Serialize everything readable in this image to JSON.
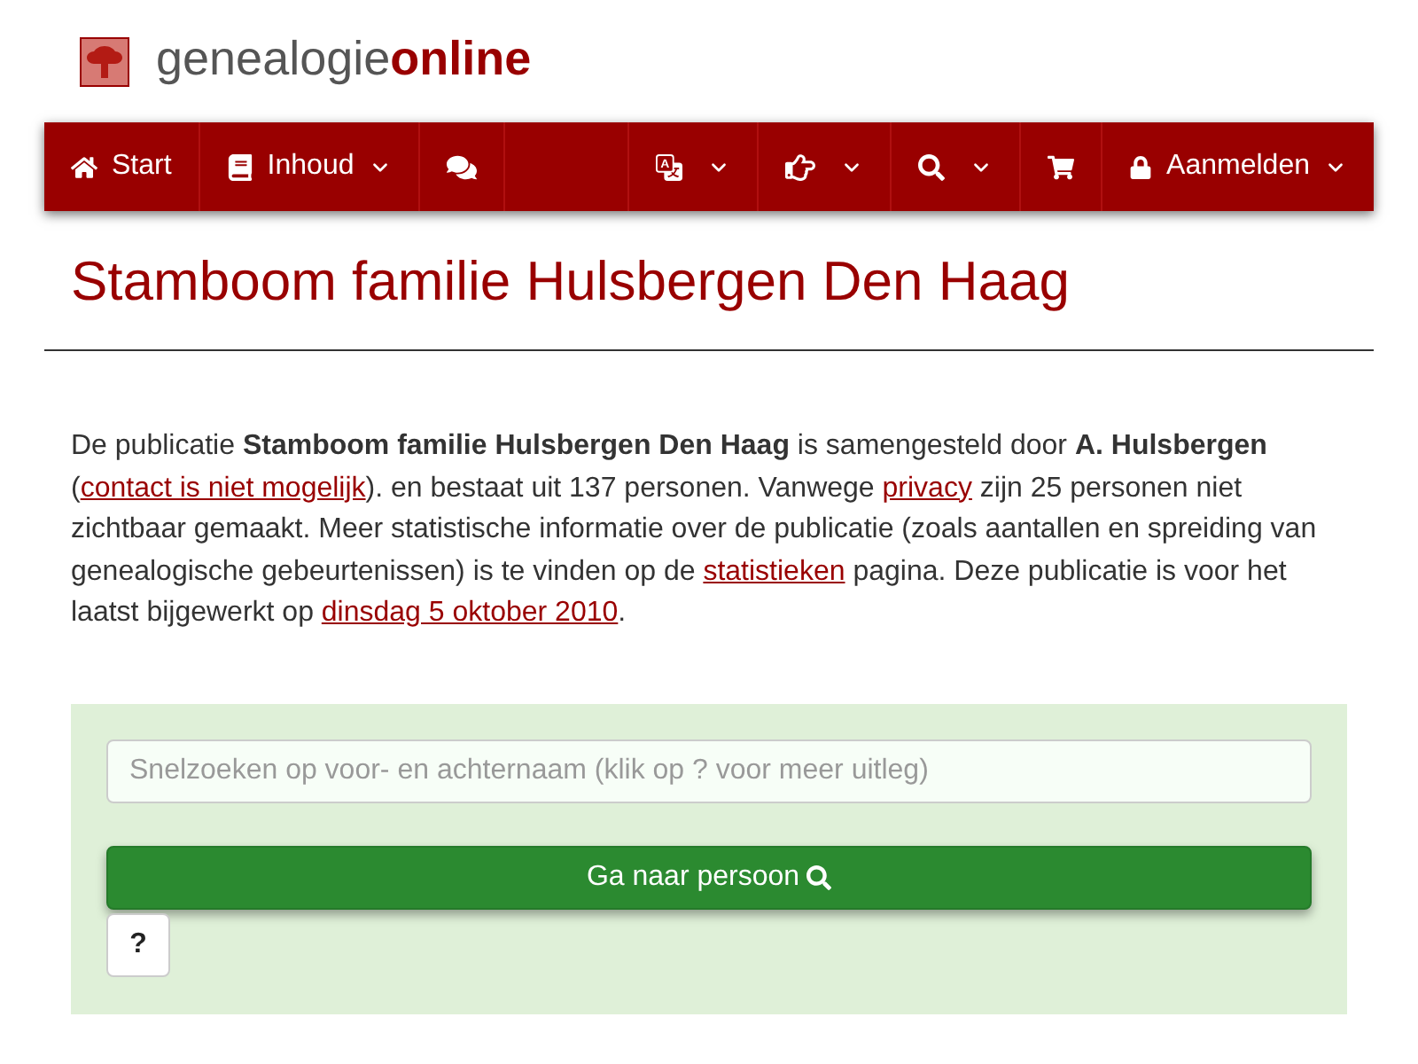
{
  "logo": {
    "text": "genealogie**online**"
  },
  "nav": {
    "left": [
      {
        "label": "Start",
        "dropdown": false
      },
      {
        "label": "Inhoud",
        "dropdown": true
      },
      {
        "dropdown": false
      }
    ],
    "right": [
      {
        "dropdown": true
      },
      {
        "dropdown": true
      },
      {
        "dropdown": true
      },
      {
        "dropdown": false
      },
      {
        "label": "Aanmelden",
        "dropdown": true
      }
    ]
  },
  "title": "Stamboom familie Hulsbergen Den Haag",
  "intro": [
    {
      "kind": "text",
      "text": "De publicatie **Stamboom familie Hulsbergen Den Haag** is samengesteld door **A. Hulsbergen** ("
    },
    {
      "kind": "link",
      "text": "contact is niet mogelijk"
    },
    {
      "kind": "text",
      "text": "). en bestaat uit 137 personen. Vanwege "
    },
    {
      "kind": "link",
      "text": "privacy"
    },
    {
      "kind": "text",
      "text": " zijn 25 personen niet zichtbaar gemaakt. Meer statistische informatie over de publicatie (zoals aantallen en spreiding van genealogische gebeurtenissen) is te vinden op de "
    },
    {
      "kind": "link",
      "text": "statistieken"
    },
    {
      "kind": "text",
      "text": " pagina. Deze publicatie is voor het laatst bijgewerkt op "
    },
    {
      "kind": "link",
      "text": "dinsdag 5 oktober 2010"
    },
    {
      "kind": "text",
      "text": "."
    }
  ],
  "search": {
    "placeholder": "Snelzoeken op voor- en achternaam (klik op ? voor meer uitleg)",
    "button": "Ga naar persoon",
    "help": "?"
  }
}
